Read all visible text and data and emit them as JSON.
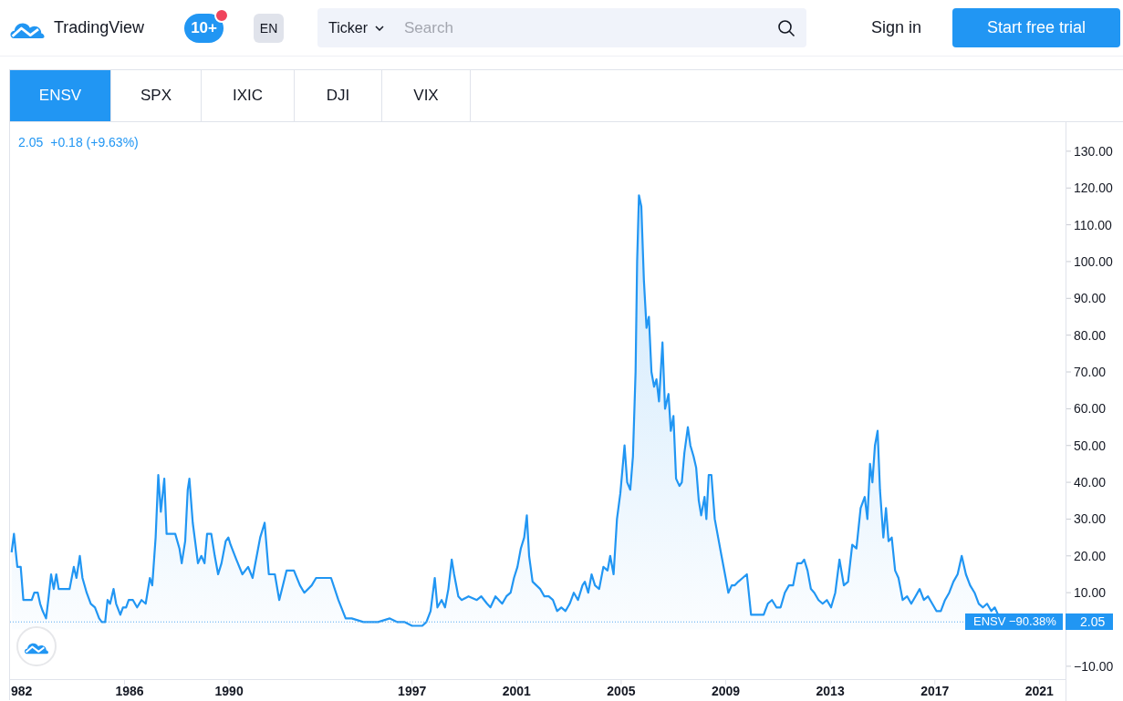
{
  "header": {
    "logo_text": "TradingView",
    "notification_badge": "10+",
    "language": "EN",
    "search": {
      "scope": "Ticker",
      "placeholder": "Search"
    },
    "sign_in": "Sign in",
    "cta": "Start free trial"
  },
  "tabs": [
    {
      "label": "ENSV",
      "selected": true
    },
    {
      "label": "SPX",
      "selected": false
    },
    {
      "label": "IXIC",
      "selected": false
    },
    {
      "label": "DJI",
      "selected": false
    },
    {
      "label": "VIX",
      "selected": false
    }
  ],
  "chart": {
    "legend": {
      "price": "2.05",
      "change": "+0.18 (+9.63%)"
    },
    "price_label": {
      "change": "−90.38%",
      "price": "2.05"
    },
    "x_axis_cut_label": "982",
    "chart_data": {
      "type": "area",
      "x": [
        1981.68,
        1981.77,
        1981.9,
        1982.03,
        1982.13,
        1982.45,
        1982.55,
        1982.68,
        1982.77,
        1982.87,
        1983,
        1983.1,
        1983.19,
        1983.29,
        1983.39,
        1983.48,
        1983.9,
        1984.06,
        1984.16,
        1984.29,
        1984.39,
        1984.55,
        1984.71,
        1984.87,
        1985.03,
        1985.13,
        1985.26,
        1985.35,
        1985.45,
        1985.58,
        1985.68,
        1985.84,
        1985.94,
        1986.06,
        1986.16,
        1986.32,
        1986.48,
        1986.65,
        1986.81,
        1986.97,
        1987.06,
        1987.19,
        1987.29,
        1987.39,
        1987.52,
        1987.61,
        1987.94,
        1988.1,
        1988.19,
        1988.32,
        1988.42,
        1988.48,
        1988.61,
        1988.81,
        1988.94,
        1989.06,
        1989.16,
        1989.32,
        1989.45,
        1989.58,
        1989.71,
        1989.87,
        1989.97,
        1990.06,
        1990.28,
        1990.51,
        1990.73,
        1990.9,
        1991.19,
        1991.36,
        1991.52,
        1991.75,
        1991.92,
        1992.2,
        1992.48,
        1992.71,
        1992.88,
        1993.16,
        1993.33,
        1993.61,
        1993.9,
        1994.18,
        1994.46,
        1994.69,
        1995.14,
        1995.7,
        1996.15,
        1996.44,
        1996.72,
        1997,
        1997.16,
        1997.39,
        1997.55,
        1997.71,
        1997.87,
        1997.97,
        1998.13,
        1998.26,
        1998.39,
        1998.52,
        1998.61,
        1998.77,
        1998.9,
        1999.16,
        1999.48,
        1999.65,
        1999.87,
        2000,
        2000.19,
        2000.45,
        2000.61,
        2000.77,
        2000.9,
        2001.03,
        2001.16,
        2001.29,
        2001.39,
        2001.48,
        2001.61,
        2001.9,
        2002.06,
        2002.23,
        2002.39,
        2002.55,
        2002.71,
        2002.87,
        2003.03,
        2003.19,
        2003.35,
        2003.52,
        2003.61,
        2003.74,
        2003.87,
        2004,
        2004.16,
        2004.32,
        2004.48,
        2004.58,
        2004.71,
        2004.84,
        2004.97,
        2005.13,
        2005.23,
        2005.35,
        2005.45,
        2005.55,
        2005.61,
        2005.68,
        2005.77,
        2005.87,
        2005.97,
        2006.06,
        2006.16,
        2006.26,
        2006.35,
        2006.45,
        2006.58,
        2006.68,
        2006.81,
        2006.9,
        2007,
        2007.1,
        2007.23,
        2007.32,
        2007.42,
        2007.55,
        2007.65,
        2007.77,
        2007.87,
        2007.97,
        2008.06,
        2008.19,
        2008.26,
        2008.35,
        2008.45,
        2008.58,
        2008.71,
        2008.84,
        2008.97,
        2009.1,
        2009.23,
        2009.35,
        2009.48,
        2009.65,
        2009.81,
        2009.97,
        2010.13,
        2010.45,
        2010.61,
        2010.77,
        2010.94,
        2011.1,
        2011.26,
        2011.42,
        2011.58,
        2011.74,
        2011.9,
        2012,
        2012.13,
        2012.26,
        2012.39,
        2012.55,
        2012.71,
        2012.87,
        2013.03,
        2013.19,
        2013.35,
        2013.52,
        2013.68,
        2013.84,
        2014,
        2014.16,
        2014.32,
        2014.42,
        2014.52,
        2014.61,
        2014.71,
        2014.81,
        2014.9,
        2015.03,
        2015.13,
        2015.23,
        2015.35,
        2015.48,
        2015.61,
        2015.77,
        2015.94,
        2016.1,
        2016.26,
        2016.42,
        2016.58,
        2016.74,
        2016.9,
        2017.06,
        2017.23,
        2017.39,
        2017.55,
        2017.71,
        2017.87,
        2018.03,
        2018.19,
        2018.35,
        2018.52,
        2018.68,
        2018.84,
        2019,
        2019.16,
        2019.29,
        2019.42
      ],
      "series": [
        {
          "name": "ENSV",
          "color": "#2196f3",
          "values": [
            21,
            26,
            17,
            17,
            8,
            8,
            10,
            10,
            7,
            5,
            3,
            9,
            15,
            11,
            15,
            11,
            11,
            17,
            14,
            20,
            14,
            10,
            7,
            6,
            3,
            2,
            2,
            8,
            7,
            11,
            7,
            4,
            6,
            6,
            8,
            8,
            6,
            8,
            7,
            14,
            12,
            25,
            42,
            32,
            41,
            26,
            26,
            22,
            18,
            24,
            38,
            41,
            29,
            18,
            20,
            18,
            26,
            26,
            20,
            15,
            18,
            24,
            25,
            23,
            19,
            15,
            17,
            14,
            25,
            29,
            15,
            15,
            8,
            16,
            16,
            12,
            10,
            12,
            14,
            14,
            14,
            8,
            3,
            3,
            2,
            2,
            3,
            2,
            2,
            1,
            1,
            1,
            2,
            5,
            14,
            6,
            8,
            6,
            11,
            19,
            15,
            9,
            8,
            9,
            8,
            9,
            7,
            6,
            9,
            7,
            9,
            10,
            14,
            17,
            22,
            25,
            31,
            20,
            13,
            11,
            9,
            9,
            8,
            5,
            6,
            5,
            7,
            10,
            8,
            12,
            13,
            10,
            15,
            12,
            11,
            17,
            16,
            20,
            15,
            30,
            37,
            50,
            40,
            38,
            47,
            70,
            100,
            118,
            115,
            95,
            82,
            85,
            70,
            66,
            68,
            62,
            78,
            60,
            64,
            54,
            58,
            41,
            39,
            40,
            48,
            55,
            50,
            47,
            44,
            35,
            31,
            36,
            30,
            42,
            42,
            30,
            25,
            20,
            15,
            10,
            12,
            12,
            13,
            14,
            15,
            4,
            4,
            4,
            7,
            8,
            6,
            6,
            10,
            12,
            12,
            18,
            18,
            19,
            16,
            11,
            10,
            8,
            7,
            8,
            6,
            10,
            19,
            12,
            13,
            23,
            22,
            33,
            36,
            30,
            45,
            40,
            50,
            54,
            38,
            25,
            33,
            24,
            25,
            16,
            14,
            8,
            9,
            7,
            9,
            11,
            8,
            9,
            7,
            5,
            5,
            8,
            10,
            13,
            15,
            20,
            15,
            12,
            10,
            7,
            6,
            7,
            5,
            6,
            4
          ]
        }
      ],
      "ylim": [
        -13.5,
        137.9
      ],
      "xlim": [
        1981.62,
        2022
      ],
      "ref_lines": [
        {
          "axis": "y",
          "value": 2.05
        }
      ],
      "yticks": [
        {
          "value": -10,
          "label": "−10.00"
        },
        {
          "value": 10,
          "label": "10.00"
        },
        {
          "value": 20,
          "label": "20.00"
        },
        {
          "value": 30,
          "label": "30.00"
        },
        {
          "value": 40,
          "label": "40.00"
        },
        {
          "value": 50,
          "label": "50.00"
        },
        {
          "value": 60,
          "label": "60.00"
        },
        {
          "value": 70,
          "label": "70.00"
        },
        {
          "value": 80,
          "label": "80.00"
        },
        {
          "value": 90,
          "label": "90.00"
        },
        {
          "value": 100,
          "label": "100.00"
        },
        {
          "value": 110,
          "label": "110.00"
        },
        {
          "value": 120,
          "label": "120.00"
        },
        {
          "value": 130,
          "label": "130.00"
        }
      ],
      "xticks": [
        {
          "value": 1986,
          "label": "1986"
        },
        {
          "value": 1990,
          "label": "1990"
        },
        {
          "value": 1997,
          "label": "1997"
        },
        {
          "value": 2001,
          "label": "2001"
        },
        {
          "value": 2005,
          "label": "2005"
        },
        {
          "value": 2009,
          "label": "2009"
        },
        {
          "value": 2013,
          "label": "2013"
        },
        {
          "value": 2017,
          "label": "2017"
        },
        {
          "value": 2021,
          "label": "2021"
        }
      ]
    }
  }
}
